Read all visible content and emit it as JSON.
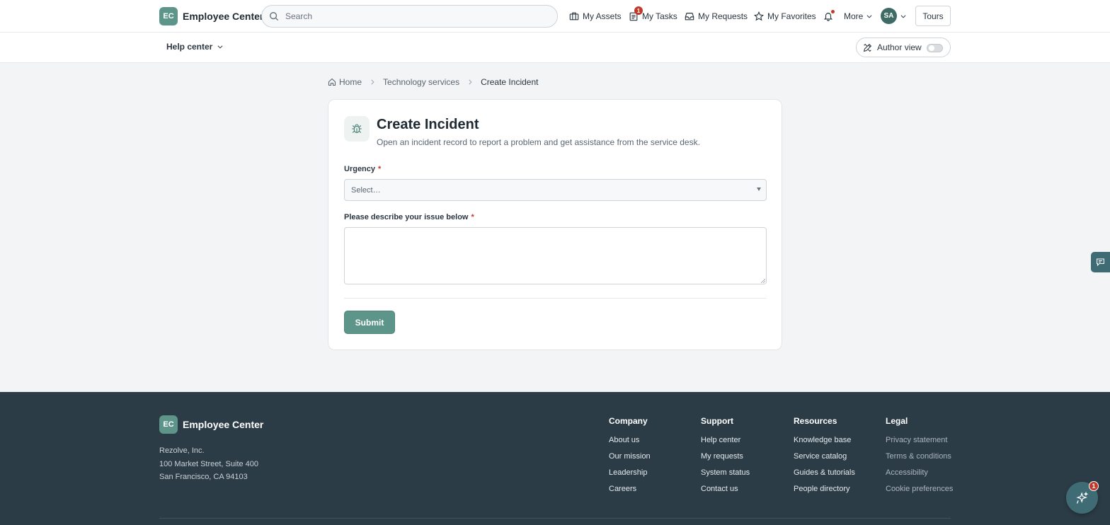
{
  "header": {
    "logo_initials": "EC",
    "brand_name": "Employee Center",
    "search_placeholder": "Search",
    "nav": {
      "assets": "My Assets",
      "tasks": "My Tasks",
      "tasks_badge": "1",
      "requests": "My Requests",
      "favorites": "My Favorites",
      "more": "More"
    },
    "avatar_initials": "SA",
    "tours_label": "Tours"
  },
  "subbar": {
    "help_center_label": "Help center",
    "author_view_label": "Author view",
    "author_view_on": false
  },
  "breadcrumb": {
    "home": "Home",
    "section": "Technology services",
    "current": "Create Incident"
  },
  "form": {
    "title": "Create Incident",
    "description": "Open an incident record to report a problem and get assistance from the service desk.",
    "urgency_label": "Urgency",
    "urgency_required": "*",
    "urgency_value": "Select…",
    "issue_label": "Please describe your issue below",
    "issue_required": "*",
    "issue_value": "",
    "submit_label": "Submit"
  },
  "footer": {
    "logo_initials": "EC",
    "brand_name": "Employee Center",
    "address": [
      "Rezolve, Inc.",
      "100 Market Street, Suite 400",
      "San Francisco, CA 94103"
    ],
    "columns": [
      {
        "title": "Company",
        "links": [
          "About us",
          "Our mission",
          "Leadership",
          "Careers"
        ]
      },
      {
        "title": "Support",
        "links": [
          "Help center",
          "My requests",
          "System status",
          "Contact us"
        ]
      },
      {
        "title": "Resources",
        "links": [
          "Knowledge base",
          "Service catalog",
          "Guides & tutorials",
          "People directory"
        ]
      },
      {
        "title": "Legal",
        "links": [
          "Privacy statement",
          "Terms & conditions",
          "Accessibility",
          "Cookie preferences"
        ]
      }
    ],
    "assistant_badge": "1"
  },
  "colors": {
    "accent": "#5d958a",
    "footer_bg": "#2c3c47",
    "badge": "#c0392b"
  }
}
